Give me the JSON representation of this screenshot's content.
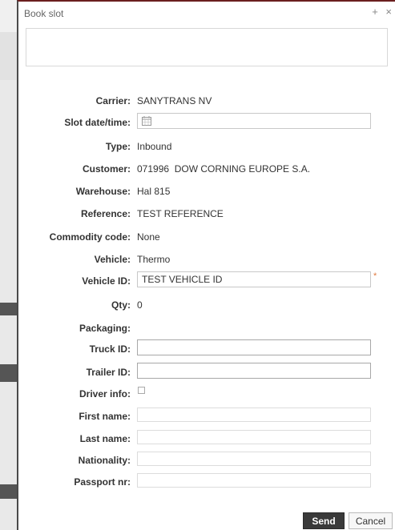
{
  "dialog": {
    "title": "Book slot",
    "icons": [
      "plus-icon",
      "close-icon"
    ],
    "plus_glyph": "+",
    "close_glyph": "×"
  },
  "form": {
    "carrier": {
      "label": "Carrier:",
      "value": "SANYTRANS NV"
    },
    "slot": {
      "label": "Slot date/time:",
      "value": ""
    },
    "type": {
      "label": "Type:",
      "value": "Inbound"
    },
    "customer": {
      "label": "Customer:",
      "value": "071996  DOW CORNING EUROPE S.A."
    },
    "warehouse": {
      "label": "Warehouse:",
      "value": "Hal 815"
    },
    "reference": {
      "label": "Reference:",
      "value": "TEST REFERENCE"
    },
    "commodity": {
      "label": "Commodity code:",
      "value": "None"
    },
    "vehicle": {
      "label": "Vehicle:",
      "value": "Thermo"
    },
    "vehicle_id": {
      "label": "Vehicle ID:",
      "value": "TEST VEHICLE ID",
      "required_mark": "*"
    },
    "qty": {
      "label": "Qty:",
      "value": "0"
    },
    "packaging": {
      "label": "Packaging:",
      "value": ""
    },
    "truck_id": {
      "label": "Truck ID:",
      "value": ""
    },
    "trailer_id": {
      "label": "Trailer ID:",
      "value": ""
    },
    "driver_info": {
      "label": "Driver info:",
      "checked": false
    },
    "first_name": {
      "label": "First name:",
      "value": ""
    },
    "last_name": {
      "label": "Last name:",
      "value": ""
    },
    "nationality": {
      "label": "Nationality:",
      "value": ""
    },
    "passport": {
      "label": "Passport nr:",
      "value": ""
    }
  },
  "buttons": {
    "send": "Send",
    "cancel": "Cancel"
  },
  "colors": {
    "accent_dark": "#3a3a3a",
    "required": "#e07a40",
    "title_border": "#6b1f1f"
  }
}
